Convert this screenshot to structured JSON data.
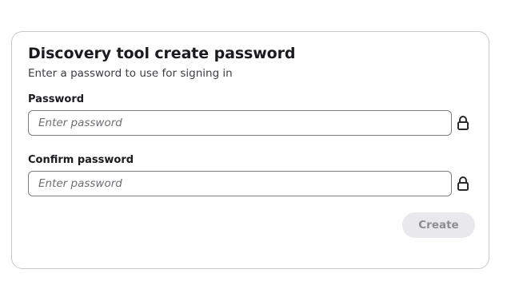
{
  "form": {
    "title": "Discovery tool create password",
    "subtitle": "Enter a password to use for signing in",
    "password": {
      "label": "Password",
      "placeholder": "Enter password",
      "value": "",
      "icon": "lock-icon"
    },
    "confirm_password": {
      "label": "Confirm password",
      "placeholder": "Enter password",
      "value": "",
      "icon": "lock-icon"
    },
    "create_button": {
      "label": "Create",
      "state": "disabled"
    }
  },
  "colors": {
    "text": "#1b1b1f",
    "border": "#c8c8cc",
    "input_border": "#7d7d83",
    "button_bg_disabled": "#e8e8ed",
    "button_text_disabled": "#8c8c92"
  }
}
